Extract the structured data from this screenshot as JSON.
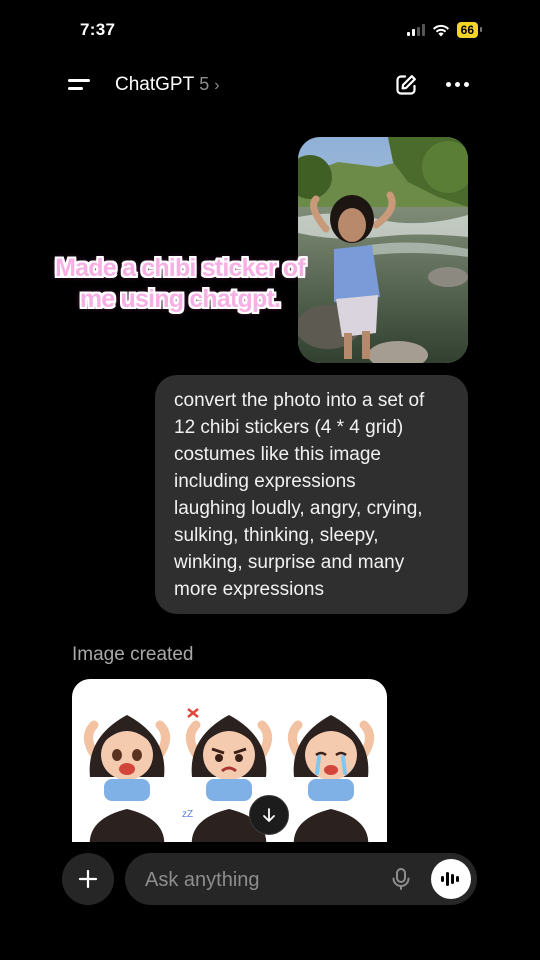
{
  "status": {
    "time": "7:37",
    "battery": "66"
  },
  "header": {
    "model_name": "ChatGPT",
    "model_version": "5",
    "chevron": "›"
  },
  "overlay": {
    "line1": "Made a chibi sticker of",
    "line2": "me using chatgpt."
  },
  "user_message": {
    "lines": [
      "convert the photo into a set of",
      "12 chibi stickers (4 * 4 grid)",
      "costumes like this image",
      "including expressions",
      "laughing loudly, angry, crying,",
      "sulking, thinking, sleepy,",
      "winking, surprise and many",
      "more expressions"
    ]
  },
  "assistant": {
    "status_label": "Image created"
  },
  "composer": {
    "placeholder": "Ask anything"
  },
  "icons": {
    "menu": "menu-icon",
    "edit": "new-chat-icon",
    "more": "more-icon",
    "scroll": "arrow-down-icon",
    "plus": "plus-icon",
    "mic": "mic-icon",
    "voice": "voice-waveform-icon"
  },
  "colors": {
    "background": "#000000",
    "bubble": "#2f2f2f",
    "caption_pink": "#f7b0e4",
    "battery": "#f4d32b"
  }
}
